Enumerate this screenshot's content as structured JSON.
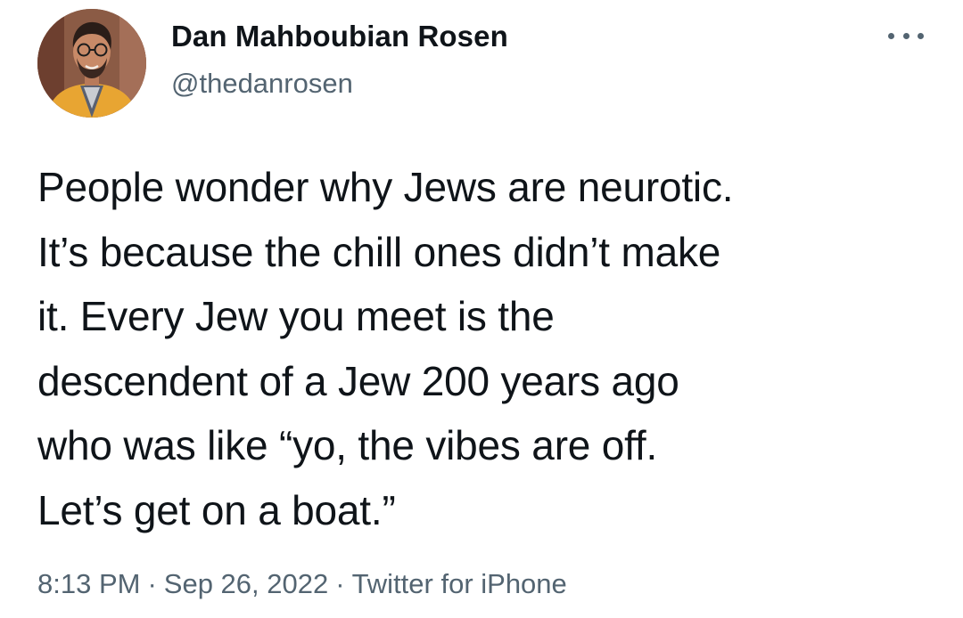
{
  "tweet": {
    "author": {
      "name": "Dan Mahboubian Rosen",
      "handle": "@thedanrosen",
      "avatar": "avatar-photo"
    },
    "more_icon": "more-horizontal-icon",
    "text": "People wonder why Jews are neurotic.\nIt’s because the chill ones didn’t make\nit. Every Jew you meet is the\ndescendent of a Jew 200 years ago\nwho was like “yo, the vibes are off.\nLet’s get on a boat.”",
    "time": "8:13 PM",
    "separator": "·",
    "date": "Sep 26, 2022",
    "source": "Twitter for iPhone"
  },
  "colors": {
    "primary_text": "#0f1419",
    "secondary_text": "#536471",
    "background": "#ffffff"
  }
}
